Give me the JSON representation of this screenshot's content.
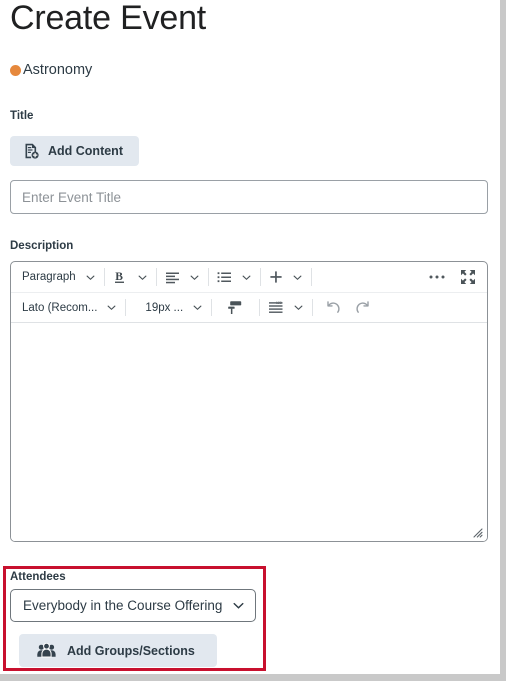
{
  "page": {
    "title": "Create Event",
    "course": {
      "name": "Astronomy",
      "dot_color": "#e6883c"
    }
  },
  "title_field": {
    "label": "Title",
    "add_content_button": "Add Content",
    "add_content_icon": "document-plus-icon",
    "input_value": "",
    "input_placeholder": "Enter Event Title"
  },
  "description_field": {
    "label": "Description",
    "editor": {
      "toolbar_row1": [
        {
          "name": "paragraph-format",
          "label": "Paragraph",
          "icon": "",
          "caret": true
        },
        {
          "name": "bold",
          "label": "",
          "icon": "bold-icon",
          "caret": true
        },
        {
          "name": "align",
          "label": "",
          "icon": "align-left-icon",
          "caret": true
        },
        {
          "name": "list",
          "label": "",
          "icon": "bullet-list-icon",
          "caret": true
        },
        {
          "name": "insert",
          "label": "",
          "icon": "plus-icon",
          "caret": true
        },
        {
          "name": "more-options",
          "label": "",
          "icon": "ellipsis-icon",
          "caret": false
        },
        {
          "name": "fullscreen",
          "label": "",
          "icon": "expand-icon",
          "caret": false
        }
      ],
      "toolbar_row2": [
        {
          "name": "font-family",
          "label": "Lato (Recom...",
          "icon": "",
          "caret": true
        },
        {
          "name": "font-size",
          "label": "19px ...",
          "icon": "",
          "caret": true
        },
        {
          "name": "format-painter",
          "label": "",
          "icon": "paint-roller-icon",
          "caret": false
        },
        {
          "name": "line-height",
          "label": "",
          "icon": "line-height-icon",
          "caret": true
        },
        {
          "name": "undo",
          "label": "",
          "icon": "undo-icon",
          "caret": false
        },
        {
          "name": "redo",
          "label": "",
          "icon": "redo-icon",
          "caret": false
        }
      ],
      "body_text": ""
    }
  },
  "attendees": {
    "label": "Attendees",
    "selected": "Everybody in the Course Offering",
    "add_groups_button": "Add Groups/Sections",
    "add_groups_icon": "group-people-icon",
    "highlight_color": "#c8102e"
  }
}
